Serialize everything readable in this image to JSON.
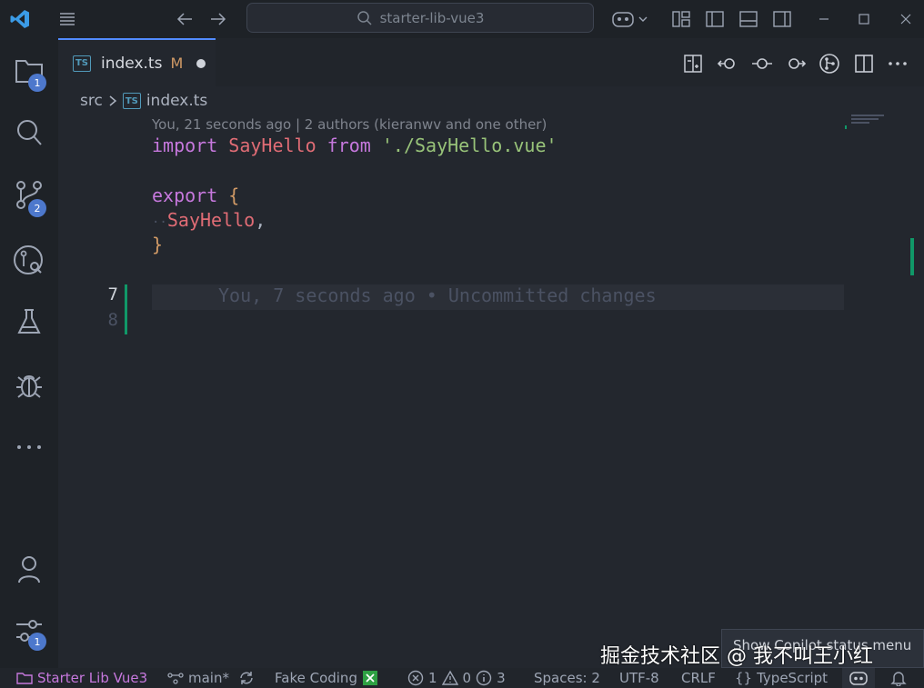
{
  "titlebar": {
    "search_text": "starter-lib-vue3",
    "icons": [
      "vscode-logo-icon",
      "menu-icon",
      "back-arrow-icon",
      "forward-arrow-icon",
      "search-icon",
      "copilot-icon",
      "customize-layout-icon",
      "toggle-primary-sidebar-icon",
      "toggle-panel-icon",
      "toggle-secondary-sidebar-icon",
      "minimize-icon",
      "maximize-icon",
      "close-icon"
    ]
  },
  "activitybar": {
    "explorer_badge": "1",
    "scm_badge": "2",
    "manage_badge": "1"
  },
  "tab": {
    "filename": "index.ts",
    "file_icon": "TS",
    "status": "M"
  },
  "breadcrumb": {
    "folder": "src",
    "file_icon": "TS",
    "file": "index.ts"
  },
  "codelens": "You, 21 seconds ago | 2 authors (kieranwv and one other)",
  "code": {
    "line1": {
      "kw1": "import",
      "name": "SayHello",
      "kw2": "from",
      "str": "'./SayHello.vue'"
    },
    "line3": {
      "kw": "export",
      "open": "{"
    },
    "line4": {
      "indent": "··",
      "name": "SayHello",
      "comma": ","
    },
    "line5": {
      "close": "}"
    },
    "line7_number": "7",
    "line8_number": "8",
    "blame": "You, 7 seconds ago • Uncommitted changes"
  },
  "statusbar": {
    "project": "Starter Lib Vue3",
    "branch": "main*",
    "fake_coding": "Fake Coding",
    "errors": "1",
    "warnings": "0",
    "infos": "3",
    "spaces": "Spaces: 2",
    "encoding": "UTF-8",
    "eol": "CRLF",
    "language_icon": "{}",
    "language": "TypeScript"
  },
  "tooltip": "Show Copilot status menu",
  "watermark": "掘金技术社区 @ 我不叫王小红",
  "colors": {
    "accent": "#528bff",
    "badge": "#4d78cc",
    "keyword": "#c678dd",
    "identifier": "#e06c75",
    "string": "#98c379",
    "git_added": "#109868"
  }
}
